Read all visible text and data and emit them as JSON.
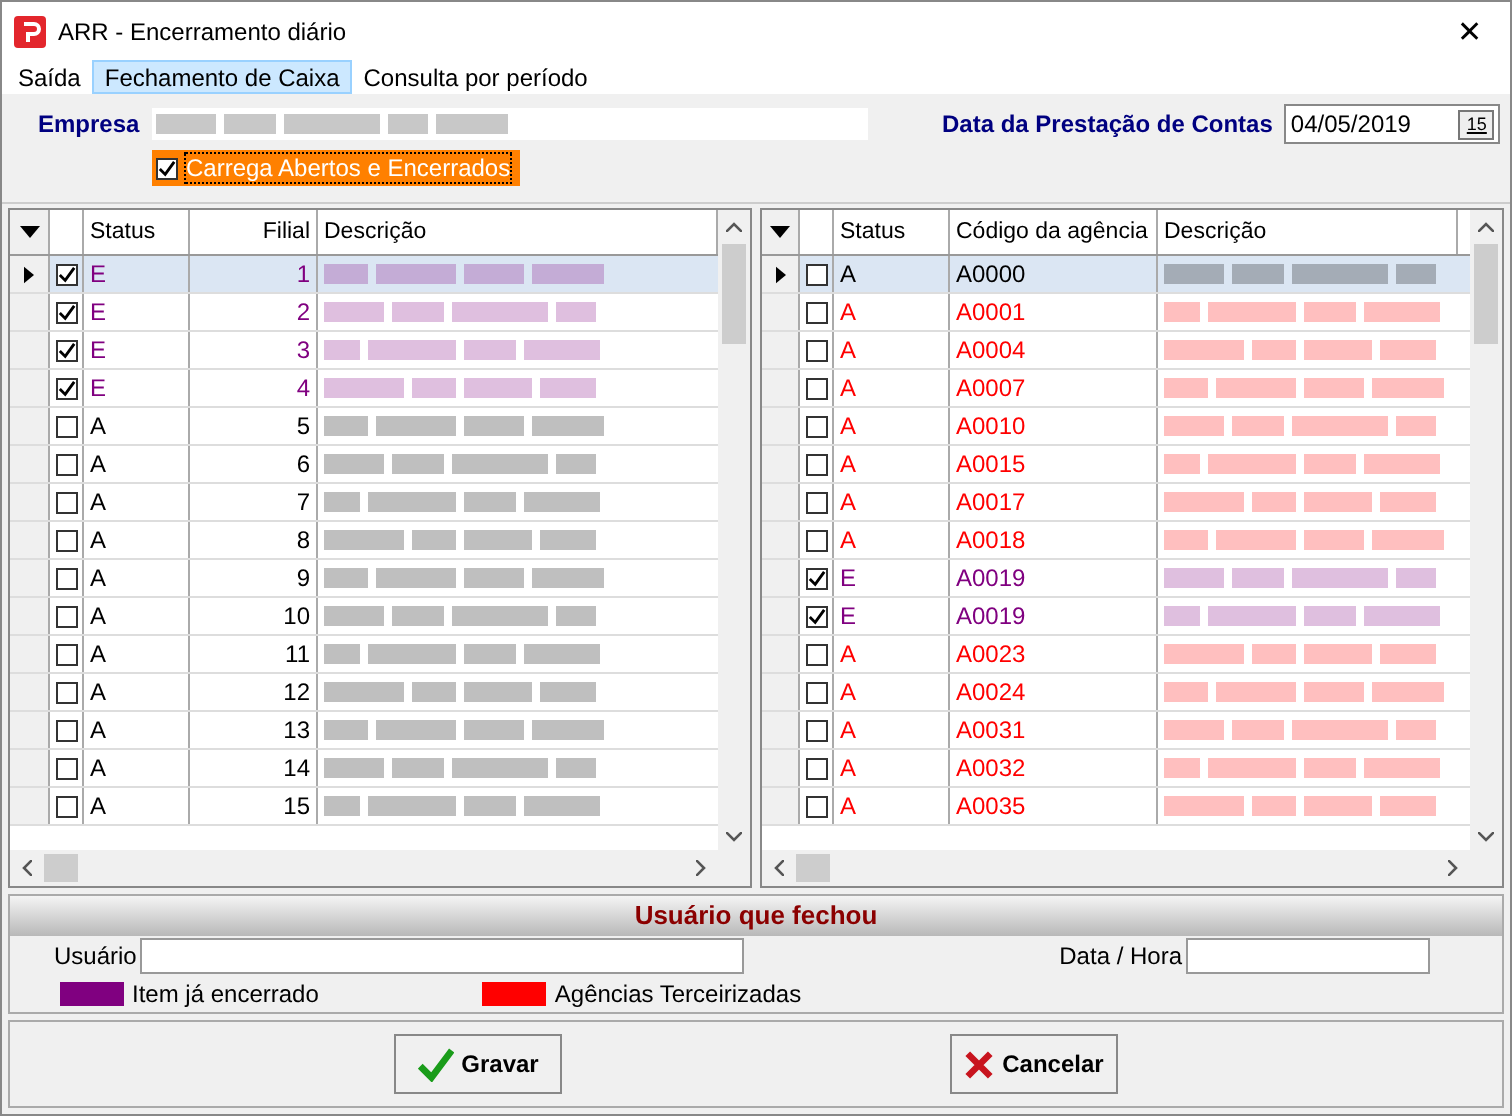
{
  "window": {
    "title": "ARR - Encerramento diário",
    "close": "✕"
  },
  "menu": [
    {
      "label": "Saída",
      "selected": false
    },
    {
      "label": "Fechamento de Caixa",
      "selected": true
    },
    {
      "label": "Consulta por período",
      "selected": false
    }
  ],
  "empresa": {
    "label": "Empresa"
  },
  "carrega": {
    "label": "Carrega Abertos e Encerrados",
    "checked": true
  },
  "data_prestacao": {
    "label": "Data da Prestação de Contas",
    "value": "04/05/2019",
    "button": "15"
  },
  "left_grid": {
    "columns": [
      "Status",
      "Filial",
      "Descrição"
    ],
    "rows": [
      {
        "status": "E",
        "filial": "1",
        "checked": true,
        "selected": true,
        "color": "#800080"
      },
      {
        "status": "E",
        "filial": "2",
        "checked": true,
        "selected": false,
        "color": "#800080"
      },
      {
        "status": "E",
        "filial": "3",
        "checked": true,
        "selected": false,
        "color": "#800080"
      },
      {
        "status": "E",
        "filial": "4",
        "checked": true,
        "selected": false,
        "color": "#800080"
      },
      {
        "status": "A",
        "filial": "5",
        "checked": false,
        "selected": false,
        "color": "#000000"
      },
      {
        "status": "A",
        "filial": "6",
        "checked": false,
        "selected": false,
        "color": "#000000"
      },
      {
        "status": "A",
        "filial": "7",
        "checked": false,
        "selected": false,
        "color": "#000000"
      },
      {
        "status": "A",
        "filial": "8",
        "checked": false,
        "selected": false,
        "color": "#000000"
      },
      {
        "status": "A",
        "filial": "9",
        "checked": false,
        "selected": false,
        "color": "#000000"
      },
      {
        "status": "A",
        "filial": "10",
        "checked": false,
        "selected": false,
        "color": "#000000"
      },
      {
        "status": "A",
        "filial": "11",
        "checked": false,
        "selected": false,
        "color": "#000000"
      },
      {
        "status": "A",
        "filial": "12",
        "checked": false,
        "selected": false,
        "color": "#000000"
      },
      {
        "status": "A",
        "filial": "13",
        "checked": false,
        "selected": false,
        "color": "#000000"
      },
      {
        "status": "A",
        "filial": "14",
        "checked": false,
        "selected": false,
        "color": "#000000"
      },
      {
        "status": "A",
        "filial": "15",
        "checked": false,
        "selected": false,
        "color": "#000000"
      }
    ]
  },
  "right_grid": {
    "columns": [
      "Status",
      "Código da agência",
      "Descrição"
    ],
    "rows": [
      {
        "status": "A",
        "code": "A0000",
        "checked": false,
        "selected": true,
        "color": "#000000"
      },
      {
        "status": "A",
        "code": "A0001",
        "checked": false,
        "selected": false,
        "color": "#ff0000"
      },
      {
        "status": "A",
        "code": "A0004",
        "checked": false,
        "selected": false,
        "color": "#ff0000"
      },
      {
        "status": "A",
        "code": "A0007",
        "checked": false,
        "selected": false,
        "color": "#ff0000"
      },
      {
        "status": "A",
        "code": "A0010",
        "checked": false,
        "selected": false,
        "color": "#ff0000"
      },
      {
        "status": "A",
        "code": "A0015",
        "checked": false,
        "selected": false,
        "color": "#ff0000"
      },
      {
        "status": "A",
        "code": "A0017",
        "checked": false,
        "selected": false,
        "color": "#ff0000"
      },
      {
        "status": "A",
        "code": "A0018",
        "checked": false,
        "selected": false,
        "color": "#ff0000"
      },
      {
        "status": "E",
        "code": "A0019",
        "checked": true,
        "selected": false,
        "color": "#800080"
      },
      {
        "status": "E",
        "code": "A0019",
        "checked": true,
        "selected": false,
        "color": "#800080"
      },
      {
        "status": "A",
        "code": "A0023",
        "checked": false,
        "selected": false,
        "color": "#ff0000"
      },
      {
        "status": "A",
        "code": "A0024",
        "checked": false,
        "selected": false,
        "color": "#ff0000"
      },
      {
        "status": "A",
        "code": "A0031",
        "checked": false,
        "selected": false,
        "color": "#ff0000"
      },
      {
        "status": "A",
        "code": "A0032",
        "checked": false,
        "selected": false,
        "color": "#ff0000"
      },
      {
        "status": "A",
        "code": "A0035",
        "checked": false,
        "selected": false,
        "color": "#ff0000"
      }
    ]
  },
  "section_title": "Usuário que fechou",
  "usuario": {
    "label": "Usuário"
  },
  "data_hora": {
    "label": "Data / Hora"
  },
  "legend": [
    {
      "label": "Item já encerrado",
      "color": "#800080"
    },
    {
      "label": "Agências Terceirizadas",
      "color": "#ff0000"
    }
  ],
  "buttons": [
    {
      "label": "Gravar",
      "kind": "ok"
    },
    {
      "label": "Cancelar",
      "kind": "cancel"
    }
  ]
}
